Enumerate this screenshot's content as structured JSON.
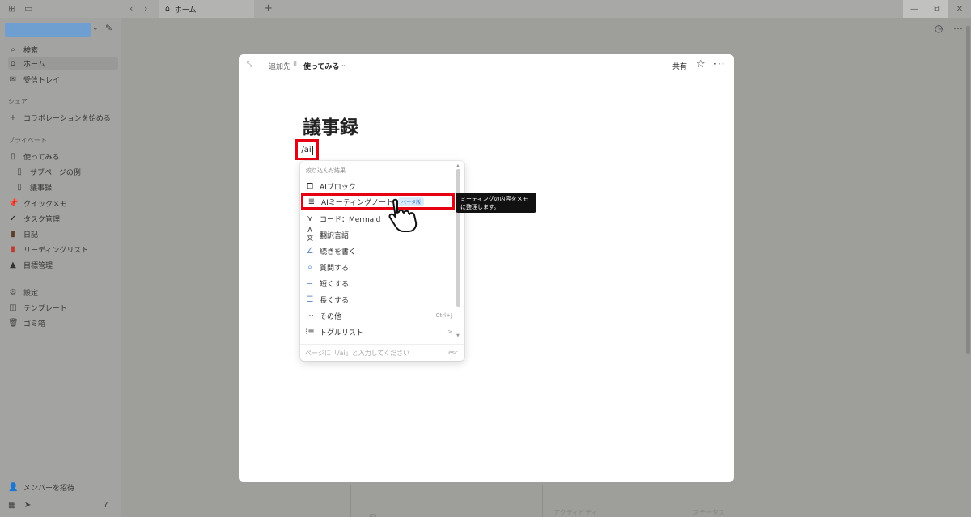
{
  "tab": {
    "title": "ホーム"
  },
  "sidebar": {
    "search": "検索",
    "home": "ホーム",
    "inbox": "受信トレイ",
    "share_section": "シェア",
    "start_collab": "コラボレーションを始める",
    "private_section": "プライベート",
    "pages": [
      {
        "label": "使ってみる",
        "icon": "page-icon"
      },
      {
        "label": "サブページの例",
        "icon": "page-icon"
      },
      {
        "label": "議事録",
        "icon": "page-icon"
      },
      {
        "label": "クイックメモ",
        "icon": "pin-icon"
      },
      {
        "label": "タスク管理",
        "icon": "check-icon"
      },
      {
        "label": "日記",
        "icon": "book-icon"
      },
      {
        "label": "リーディングリスト",
        "icon": "book-red-icon"
      },
      {
        "label": "目標管理",
        "icon": "mountain-icon"
      }
    ],
    "settings": "設定",
    "templates": "テンプレート",
    "trash": "ゴミ箱",
    "invite": "メンバーを招待"
  },
  "modal": {
    "add_to": "追加先",
    "page": "使ってみる",
    "share": "共有",
    "title": "議事録",
    "input": "/ai"
  },
  "menu": {
    "header": "絞り込んだ結果",
    "items": [
      {
        "label": "AIブロック",
        "icon": "ai-block-icon",
        "shortcut": ""
      },
      {
        "label": "AIミーティングノート",
        "icon": "meeting-notes-icon",
        "badge": "ベータ版",
        "shortcut": ""
      },
      {
        "label": "コード：Mermaid",
        "icon": "mermaid-icon",
        "shortcut": ""
      },
      {
        "label": "翻訳言語",
        "icon": "translate-icon",
        "shortcut": ""
      },
      {
        "label": "続きを書く",
        "icon": "pen-icon",
        "shortcut": ""
      },
      {
        "label": "質問する",
        "icon": "search-icon",
        "shortcut": ""
      },
      {
        "label": "短くする",
        "icon": "shorten-icon",
        "shortcut": ""
      },
      {
        "label": "長くする",
        "icon": "lengthen-icon",
        "shortcut": ""
      },
      {
        "label": "その他",
        "icon": "more-icon",
        "shortcut": "Ctrl+J"
      },
      {
        "label": "トグルリスト",
        "icon": "toggle-list-icon",
        "shortcut": ">"
      }
    ],
    "footer": "ページに「/ai」と入力してください",
    "esc": "esc"
  },
  "tooltip": "ミーティングの内容をメモに整理します。",
  "bottom": {
    "left": "",
    "mid": "アクティビティ",
    "right": "ステータス"
  }
}
